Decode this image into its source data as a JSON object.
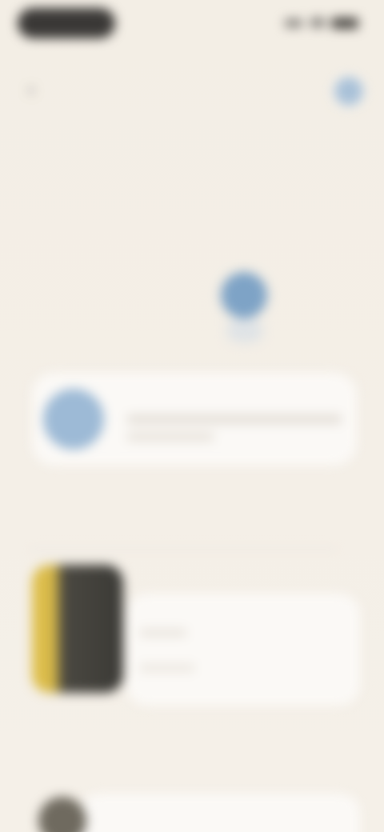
{
  "status_bar": {
    "icons": [
      "signal-icon",
      "wifi-icon",
      "battery-icon"
    ]
  },
  "header": {
    "back_glyph": "‹",
    "profile_icon": "profile-icon"
  },
  "page": {
    "title": "",
    "subtitle": "",
    "mini_label": ""
  },
  "assistant": {
    "name": "",
    "line1": "",
    "line2": ""
  },
  "sections": {
    "first": "",
    "second": ""
  },
  "featured": {
    "title": "",
    "meta1": "",
    "meta2": ""
  },
  "colors": {
    "background": "#f4efe6",
    "accent_blue": "#7ea3c6",
    "card": "#fbf9f6",
    "thumbnail_yellow": "#e0c04a",
    "thumbnail_dark": "#3b3a36"
  }
}
